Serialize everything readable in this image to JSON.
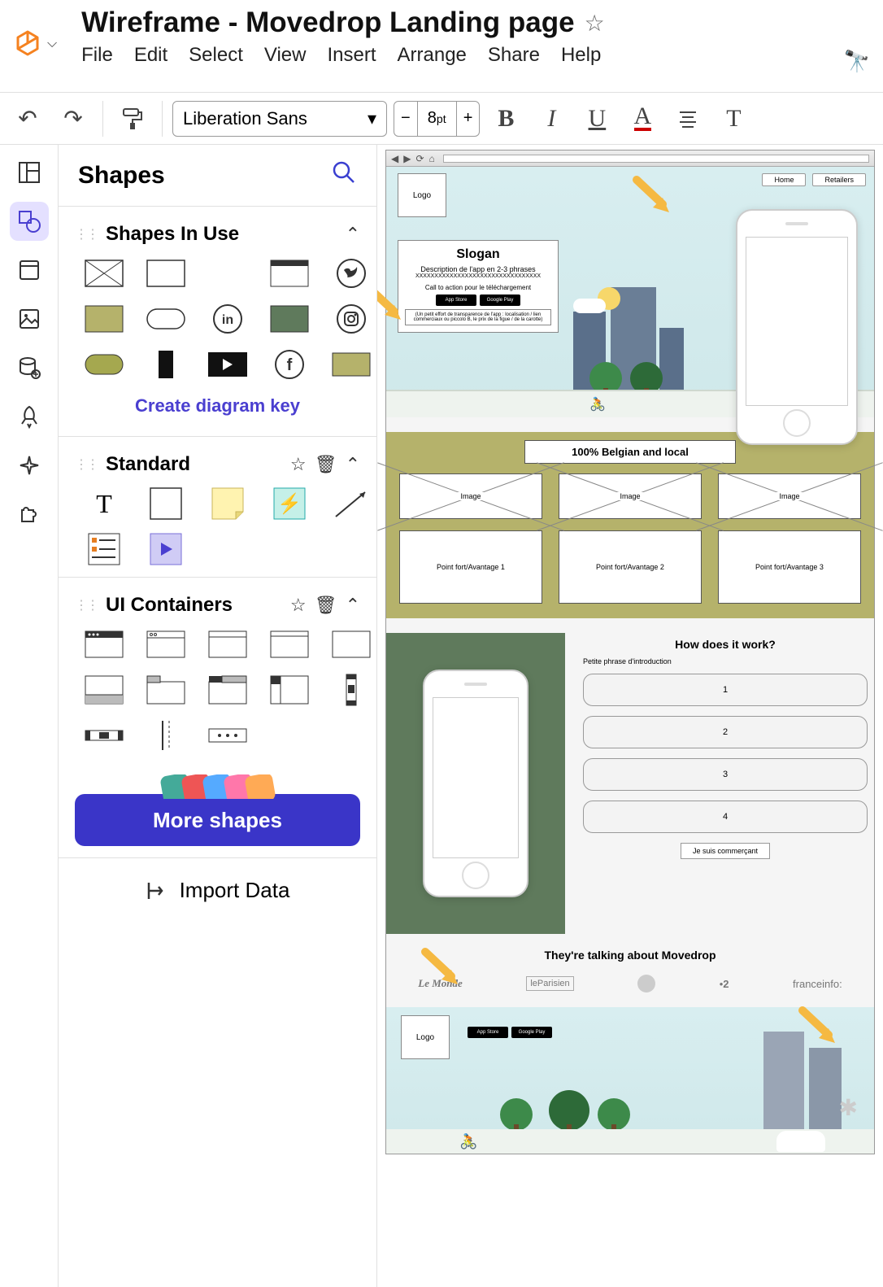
{
  "app": {
    "document_title": "Wireframe - Movedrop Landing page"
  },
  "menubar": {
    "file": "File",
    "edit": "Edit",
    "select": "Select",
    "view": "View",
    "insert": "Insert",
    "arrange": "Arrange",
    "share": "Share",
    "help": "Help"
  },
  "toolbar": {
    "font_family": "Liberation Sans",
    "font_size": "8",
    "font_unit": "pt"
  },
  "panel": {
    "title": "Shapes",
    "sections": {
      "in_use": {
        "title": "Shapes In Use",
        "diagram_key": "Create diagram key"
      },
      "standard": {
        "title": "Standard"
      },
      "ui_containers": {
        "title": "UI Containers"
      }
    },
    "more_shapes": "More shapes",
    "import_data": "Import Data"
  },
  "wireframe": {
    "nav": {
      "home": "Home",
      "retailers": "Retailers"
    },
    "logo": "Logo",
    "slogan": {
      "title": "Slogan",
      "desc": "Description de l'app en 2-3 phrases",
      "filler": "XXXXXXXXXXXXXXXXXXXXXXXXXXXXXXXXX",
      "cta": "Call to action pour le téléchargement",
      "note": "(Un petit effort de transparence de l'app : localisation / lien commerciaux ou piccolo B, le prix de la figue / de la carotte)",
      "appstore": "App Store",
      "googleplay": "Google Play"
    },
    "belgian": {
      "title": "100% Belgian and local",
      "img": "Image",
      "adv1": "Point fort/Avantage 1",
      "adv2": "Point fort/Avantage 2",
      "adv3": "Point fort/Avantage 3"
    },
    "how": {
      "title": "How does it work?",
      "sub": "Petite phrase d'introduction",
      "step1": "1",
      "step2": "2",
      "step3": "3",
      "step4": "4",
      "merchant": "Je suis commerçant"
    },
    "press": {
      "title": "They're talking about Movedrop",
      "lemonde": "Le Monde",
      "parisien": "leParisien",
      "france2": "2",
      "franceinfo": "franceinfo:"
    }
  }
}
